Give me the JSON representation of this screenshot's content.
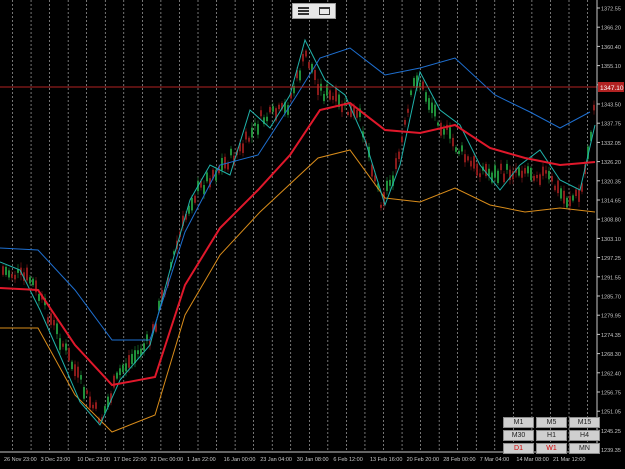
{
  "toolbar": {
    "menu_icon": "hamburger-menu-icon",
    "window_icon": "window-icon"
  },
  "price_axis": {
    "labels": [
      "1372.55",
      "1366.20",
      "1360.40",
      "1355.10",
      "1349.30",
      "1343.50",
      "1337.75",
      "1332.05",
      "1326.20",
      "1320.35",
      "1314.65",
      "1308.80",
      "1303.10",
      "1297.25",
      "1291.55",
      "1285.70",
      "1279.95",
      "1274.35",
      "1268.30",
      "1262.40",
      "1256.75",
      "1251.05",
      "1245.25",
      "1239.35"
    ],
    "current_price": "1347.10",
    "current_price_color": "#b22222"
  },
  "time_axis": {
    "labels": [
      "26 Nov 23:00",
      "3 Dec 23:00",
      "10 Dec 23:00",
      "17 Dec 22:00",
      "22 Dec 00:00",
      "1 Jan 22:00",
      "16 Jan 00:00",
      "23 Jan 04:00",
      "30 Jan 08:00",
      "6 Feb 12:00",
      "13 Feb 16:00",
      "20 Feb 20:00",
      "28 Feb 00:00",
      "7 Mar 04:00",
      "14 Mar 08:00",
      "21 Mar 12:00"
    ]
  },
  "colors": {
    "background": "#000000",
    "grid": "#c0c0c0",
    "axis_text": "#c8c8c8",
    "line_blue": "#1e6fd0",
    "line_cyan": "#20b2aa",
    "line_red": "#e0182b",
    "line_orange": "#d98c1a",
    "candle_green": "#1f8f3a",
    "candle_red": "#8b1a1a"
  },
  "timeframes": {
    "labels": [
      "M1",
      "M5",
      "M15",
      "M30",
      "H1",
      "H4",
      "D1",
      "W1",
      "MN"
    ],
    "active": [
      "D1",
      "W1"
    ]
  }
}
